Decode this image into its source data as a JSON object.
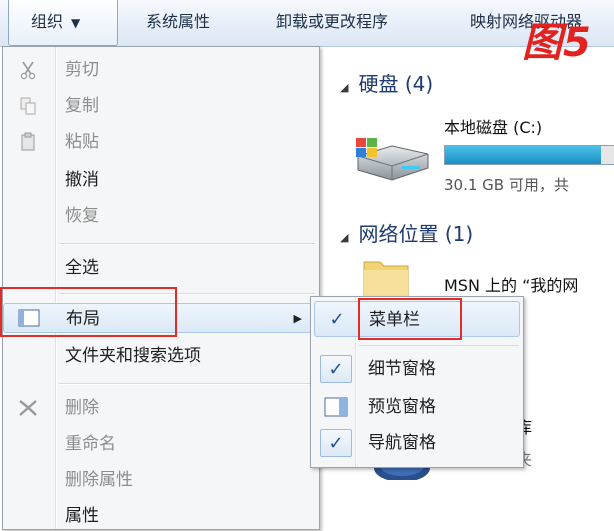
{
  "toolbar": {
    "organize_label": "组织",
    "system_properties": "系统属性",
    "uninstall": "卸载或更改程序",
    "map_drive_partial": "映射网络驱动器"
  },
  "figure_tag": "图5",
  "content": {
    "hard_disk_section": "硬盘 (4)",
    "local_disk_name": "本地磁盘 (C:)",
    "local_disk_space": "30.1 GB 可用，共",
    "local_disk_usage_fraction": 0.92,
    "network_section": "网络位置 (1)",
    "network_item": "MSN 上的 “我的网",
    "library_fragment": "库",
    "library_fragment2": "夹"
  },
  "organize_menu": {
    "items": [
      {
        "label": "剪切",
        "icon": "scissors-icon",
        "enabled": false
      },
      {
        "label": "复制",
        "icon": "copy-icon",
        "enabled": false
      },
      {
        "label": "粘贴",
        "icon": "clipboard-icon",
        "enabled": false
      },
      {
        "label": "撤消",
        "icon": "",
        "enabled": true
      },
      {
        "label": "恢复",
        "icon": "",
        "enabled": false
      },
      {
        "label": "全选",
        "icon": "",
        "enabled": true
      },
      {
        "label": "布局",
        "icon": "layout-icon",
        "enabled": true,
        "has_submenu": true
      },
      {
        "label": "文件夹和搜索选项",
        "icon": "",
        "enabled": true
      },
      {
        "label": "删除",
        "icon": "delete-x-icon",
        "enabled": false
      },
      {
        "label": "重命名",
        "icon": "",
        "enabled": false
      },
      {
        "label": "删除属性",
        "icon": "",
        "enabled": false
      },
      {
        "label": "属性",
        "icon": "",
        "enabled": true
      }
    ]
  },
  "layout_submenu": {
    "items": [
      {
        "label": "菜单栏",
        "checked": true
      },
      {
        "label": "细节窗格",
        "checked": true
      },
      {
        "label": "预览窗格",
        "checked": false
      },
      {
        "label": "导航窗格",
        "checked": true
      }
    ]
  },
  "colors": {
    "highlight_box": "#e42b25",
    "figure_tag": "#e2221e",
    "check_mark": "#1f4f98"
  }
}
